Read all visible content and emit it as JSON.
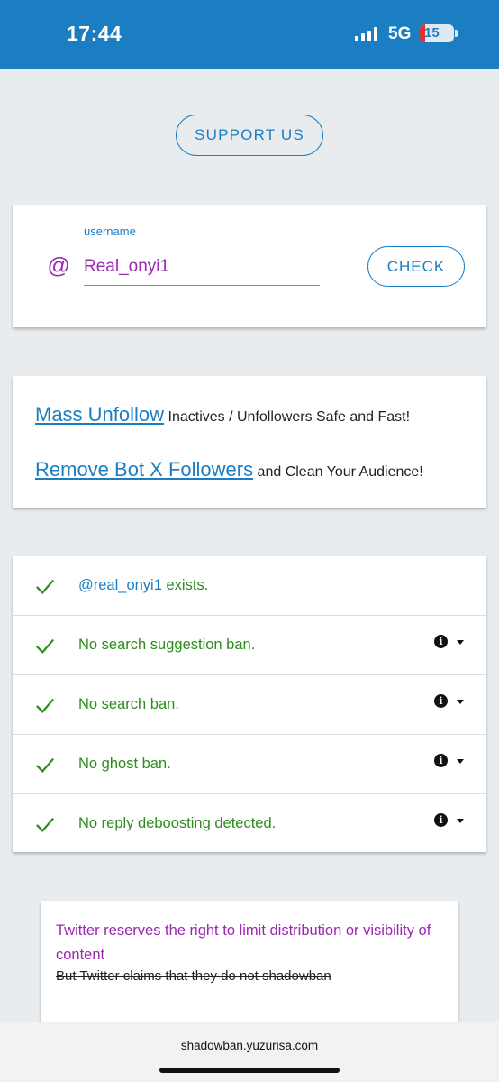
{
  "status_bar": {
    "time": "17:44",
    "network": "5G",
    "battery_level": "15",
    "background_color": "#1b7ec2"
  },
  "support_button": {
    "label": "SUPPORT US"
  },
  "username_card": {
    "at_symbol": "@",
    "field_label": "username",
    "field_value": "Real_onyi1",
    "check_label": "CHECK"
  },
  "promo": {
    "line1_link": "Mass Unfollow",
    "line1_text": "Inactives / Unfollowers Safe and Fast!",
    "line2_link": "Remove Bot X Followers",
    "line2_text": "and Clean Your Audience!"
  },
  "results": [
    {
      "handle": "@real_onyi1",
      "text": " exists.",
      "has_info": false
    },
    {
      "handle": "",
      "text": "No search suggestion ban.",
      "has_info": true
    },
    {
      "handle": "",
      "text": "No search ban.",
      "has_info": true
    },
    {
      "handle": "",
      "text": "No ghost ban.",
      "has_info": true
    },
    {
      "handle": "",
      "text": "No reply deboosting detected.",
      "has_info": true
    }
  ],
  "notice": {
    "main": "Twitter reserves the right to limit distribution or visibility of content",
    "strikethrough": "But Twitter claims that they do not shadowban"
  },
  "browser": {
    "url": "shadowban.yuzurisa.com"
  },
  "colors": {
    "accent": "#1b7ec2",
    "success": "#2e8b1f",
    "purple": "#9c27b0"
  }
}
